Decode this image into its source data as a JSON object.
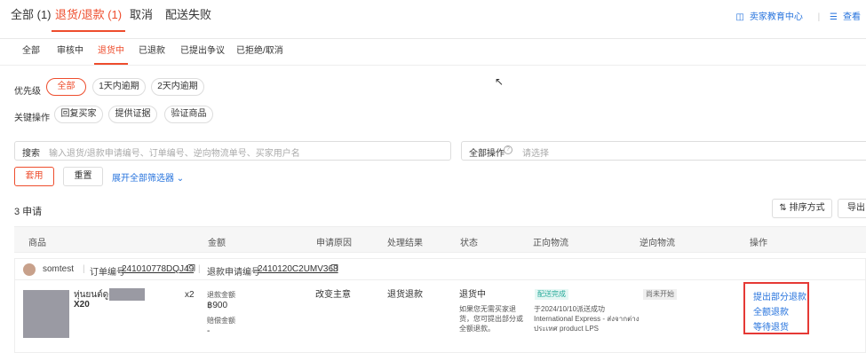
{
  "top_tabs": [
    {
      "label": "全部 (1)"
    },
    {
      "label": "退货/退款 (1)"
    },
    {
      "label": "取消"
    },
    {
      "label": "配送失败"
    }
  ],
  "top_links": {
    "seller_edu": "卖家教育中心",
    "more": "查看"
  },
  "sub_tabs": [
    "全部",
    "审核中",
    "退货中",
    "已退款",
    "已提出争议",
    "已拒绝/取消"
  ],
  "priority": {
    "label": "优先级",
    "options": [
      "全部",
      "1天内逾期",
      "2天内逾期"
    ]
  },
  "key_ops": {
    "label": "关键操作",
    "options": [
      "回复买家",
      "提供证据",
      "验证商品"
    ]
  },
  "search": {
    "label": "搜索",
    "placeholder": "输入退货/退款申请编号、订单编号、逆向物流单号、买家用户名"
  },
  "all_ops": {
    "label": "全部操作",
    "placeholder": "请选择"
  },
  "buttons": {
    "apply": "套用",
    "reset": "重置",
    "expand": "展开全部筛选器",
    "sort": "排序方式",
    "export": "导出"
  },
  "count_text": "3 申请",
  "table_headers": [
    "商品",
    "金额",
    "申请原因",
    "处理结果",
    "状态",
    "正向物流",
    "逆向物流",
    "操作"
  ],
  "order": {
    "username": "somtest",
    "order_label": "订单编号",
    "order_no": "241010778DQJ49",
    "refund_label": "退款申请编号",
    "refund_no": "2410120C2UMV368",
    "product_name": "หุ่นยนต์ดูดฝุ่",
    "product_variant": "X20",
    "qty": "x2",
    "refund_amount_label": "退款金额",
    "refund_amount": "฿900",
    "comp_label": "赔偿金额",
    "comp_amount": "-",
    "reason": "改变主意",
    "result": "退货退款",
    "status": "退货中",
    "status_desc": [
      "如果您无需买家退",
      "货，您可提出部分或",
      "全额退款。"
    ],
    "forward_tag": "配送完成",
    "forward_line1": "于2024/10/10派送成功",
    "forward_line2": "International Express - ส่งจากต่าง",
    "forward_line3": "ประเทศ product LPS",
    "reverse_tag": "尚未开始",
    "actions": [
      "提出部分退款",
      "全额退款",
      "等待退货"
    ]
  }
}
